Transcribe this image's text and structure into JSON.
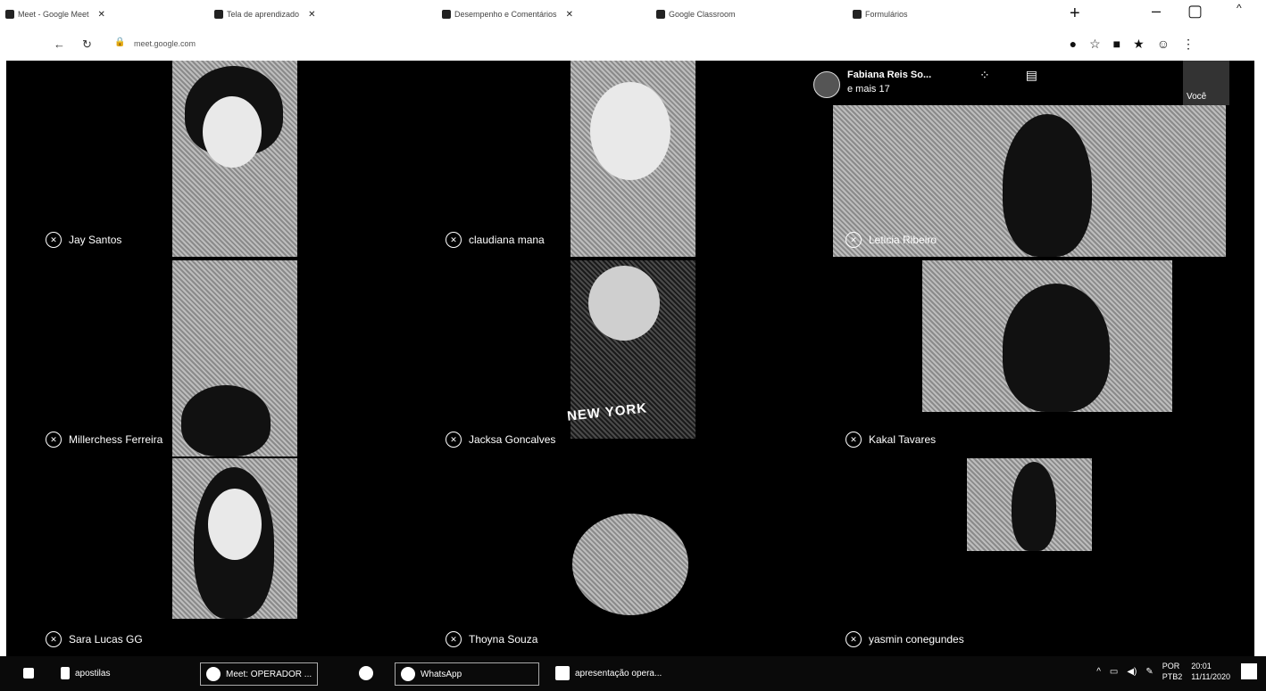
{
  "browser": {
    "tabs": [
      {
        "label": "Meet - Google Meet"
      },
      {
        "label": "Tela de aprendizado"
      },
      {
        "label": "Desempenho e Comentários"
      },
      {
        "label": "Google Classroom"
      },
      {
        "label": "Formulários"
      }
    ],
    "new_tab_label": "+",
    "url": "meet.google.com"
  },
  "meet": {
    "participants": [
      {
        "name": "Jay Santos"
      },
      {
        "name": "claudiana mana"
      },
      {
        "name": "Leticia Ribeiro"
      },
      {
        "name": "Millerchess Ferreira"
      },
      {
        "name": "Jacksa Goncalves"
      },
      {
        "name": "Kakal Tavares"
      },
      {
        "name": "Sara Lucas GG"
      },
      {
        "name": "Thoyna Souza"
      },
      {
        "name": "yasmin conegundes"
      }
    ],
    "presenter": {
      "name": "Fabiana Reis So...",
      "others": "e mais 17"
    },
    "self_label": "Você",
    "shirt_text": "NEW YORK"
  },
  "taskbar": {
    "items": [
      {
        "label": "apostilas"
      },
      {
        "label": "Meet: OPERADOR ..."
      },
      {
        "label": "WhatsApp"
      },
      {
        "label": "apresentação opera..."
      }
    ],
    "lang_top": "POR",
    "lang_bottom": "PTB2",
    "time": "20:01",
    "date": "11/11/2020"
  }
}
